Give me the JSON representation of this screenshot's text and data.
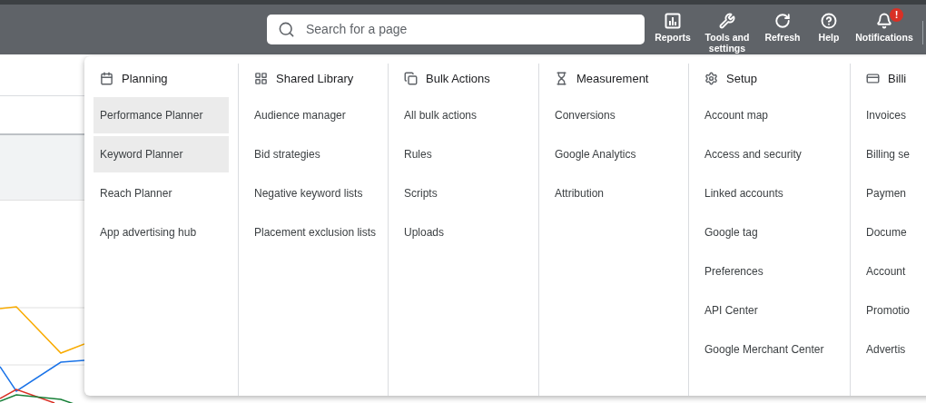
{
  "top_bar": {
    "search": {
      "placeholder": "Search for a page"
    },
    "actions": [
      {
        "label": "Reports"
      },
      {
        "label": "Tools and settings"
      },
      {
        "label": "Refresh"
      },
      {
        "label": "Help"
      },
      {
        "label": "Notifications",
        "badge": "!"
      }
    ]
  },
  "tools_menu": {
    "columns": [
      {
        "title": "Planning",
        "items": [
          {
            "label": "Performance Planner",
            "highlighted": true
          },
          {
            "label": "Keyword Planner",
            "highlighted": true
          },
          {
            "label": "Reach Planner",
            "highlighted": false
          },
          {
            "label": "App advertising hub",
            "highlighted": false
          }
        ]
      },
      {
        "title": "Shared Library",
        "items": [
          {
            "label": "Audience manager",
            "highlighted": false
          },
          {
            "label": "Bid strategies",
            "highlighted": false
          },
          {
            "label": "Negative keyword lists",
            "highlighted": false
          },
          {
            "label": "Placement exclusion lists",
            "highlighted": false
          }
        ]
      },
      {
        "title": "Bulk Actions",
        "items": [
          {
            "label": "All bulk actions",
            "highlighted": false
          },
          {
            "label": "Rules",
            "highlighted": false
          },
          {
            "label": "Scripts",
            "highlighted": false
          },
          {
            "label": "Uploads",
            "highlighted": false
          }
        ]
      },
      {
        "title": "Measurement",
        "items": [
          {
            "label": "Conversions",
            "highlighted": false
          },
          {
            "label": "Google Analytics",
            "highlighted": false
          },
          {
            "label": "Attribution",
            "highlighted": false
          }
        ]
      },
      {
        "title": "Setup",
        "items": [
          {
            "label": "Account map",
            "highlighted": false
          },
          {
            "label": "Access and security",
            "highlighted": false
          },
          {
            "label": "Linked accounts",
            "highlighted": false
          },
          {
            "label": "Google tag",
            "highlighted": false
          },
          {
            "label": "Preferences",
            "highlighted": false
          },
          {
            "label": "API Center",
            "highlighted": false
          },
          {
            "label": "Google Merchant Center",
            "highlighted": false
          }
        ]
      },
      {
        "title": "Billi",
        "items": [
          {
            "label": "Invoices",
            "highlighted": false
          },
          {
            "label": "Billing se",
            "highlighted": false
          },
          {
            "label": "Paymen",
            "highlighted": false
          },
          {
            "label": "Docume",
            "highlighted": false
          },
          {
            "label": "Account",
            "highlighted": false
          },
          {
            "label": "Promotio",
            "highlighted": false
          },
          {
            "label": "Advertis",
            "highlighted": false
          }
        ]
      }
    ]
  }
}
